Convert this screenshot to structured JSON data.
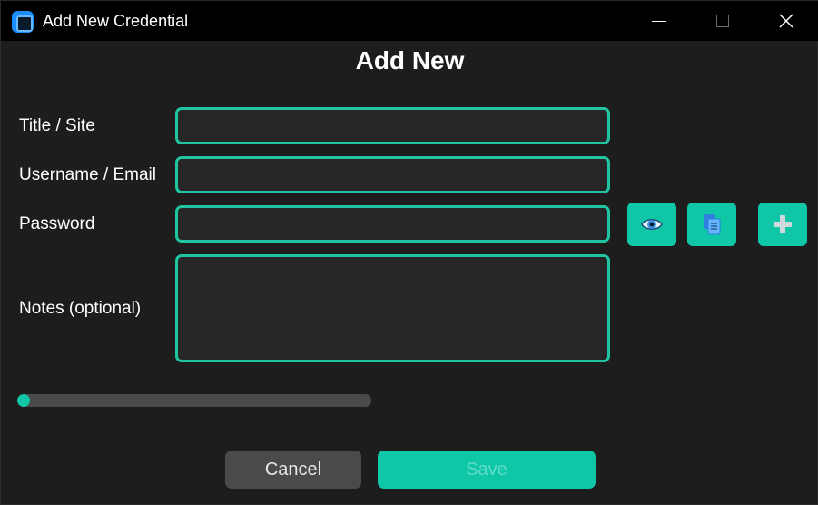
{
  "window": {
    "title": "Add New Credential",
    "icons": [
      "app-icon",
      "minimize-icon",
      "maximize-icon",
      "close-icon"
    ]
  },
  "form": {
    "heading": "Add New",
    "fields": {
      "title_label": "Title / Site",
      "title_value": "",
      "username_label": "Username / Email",
      "username_value": "",
      "password_label": "Password",
      "password_value": "",
      "notes_label": "Notes (optional)",
      "notes_value": ""
    },
    "password_actions": [
      "eye-icon",
      "copy-icon",
      "plus-icon"
    ],
    "strength_meter": {
      "fraction": 0.02
    },
    "buttons": {
      "cancel_label": "Cancel",
      "save_label": "Save"
    }
  },
  "colors": {
    "accent": "#0fc7a7",
    "field_border": "#21c4a0",
    "background": "#1d1d1d",
    "titlebar": "#000000"
  }
}
